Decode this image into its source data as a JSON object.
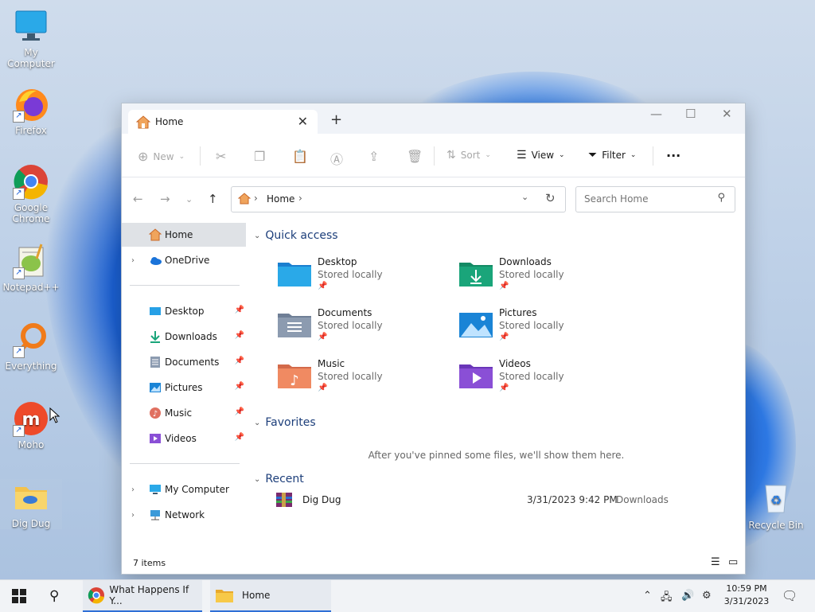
{
  "desktop": {
    "icons": [
      {
        "label": "My Computer"
      },
      {
        "label": "Firefox"
      },
      {
        "label": "Google Chrome"
      },
      {
        "label": "Notepad++"
      },
      {
        "label": "Everything"
      },
      {
        "label": "Moho"
      },
      {
        "label": "Dig Dug"
      },
      {
        "label": "Recycle Bin"
      }
    ]
  },
  "window": {
    "tab_label": "Home",
    "new_tab_symbol": "+",
    "toolbar": {
      "new_label": "New",
      "sort_label": "Sort",
      "view_label": "View",
      "filter_label": "Filter",
      "more_label": "..."
    },
    "address": {
      "segment": "Home"
    },
    "search": {
      "placeholder": "Search Home"
    },
    "sidebar": {
      "home": "Home",
      "onedrive": "OneDrive",
      "pinned": [
        "Desktop",
        "Downloads",
        "Documents",
        "Pictures",
        "Music",
        "Videos"
      ],
      "my_computer": "My Computer",
      "network": "Network"
    },
    "quick_access": {
      "title": "Quick access",
      "items": [
        {
          "name": "Desktop",
          "status": "Stored locally"
        },
        {
          "name": "Downloads",
          "status": "Stored locally"
        },
        {
          "name": "Documents",
          "status": "Stored locally"
        },
        {
          "name": "Pictures",
          "status": "Stored locally"
        },
        {
          "name": "Music",
          "status": "Stored locally"
        },
        {
          "name": "Videos",
          "status": "Stored locally"
        }
      ]
    },
    "favorites": {
      "title": "Favorites",
      "empty_message": "After you've pinned some files, we'll show them here."
    },
    "recent": {
      "title": "Recent",
      "items": [
        {
          "name": "Dig Dug",
          "date": "3/31/2023 9:42 PM",
          "location": "Downloads"
        }
      ]
    },
    "status": {
      "item_count": "7 items"
    }
  },
  "taskbar": {
    "apps": [
      {
        "label": "What Happens If Y..."
      },
      {
        "label": "Home"
      }
    ],
    "clock": {
      "time": "10:59 PM",
      "date": "3/31/2023"
    }
  },
  "colors": {
    "accent": "#2f6fd6",
    "folder_blue": "#1e8fe0",
    "folder_green": "#1aa57a"
  }
}
